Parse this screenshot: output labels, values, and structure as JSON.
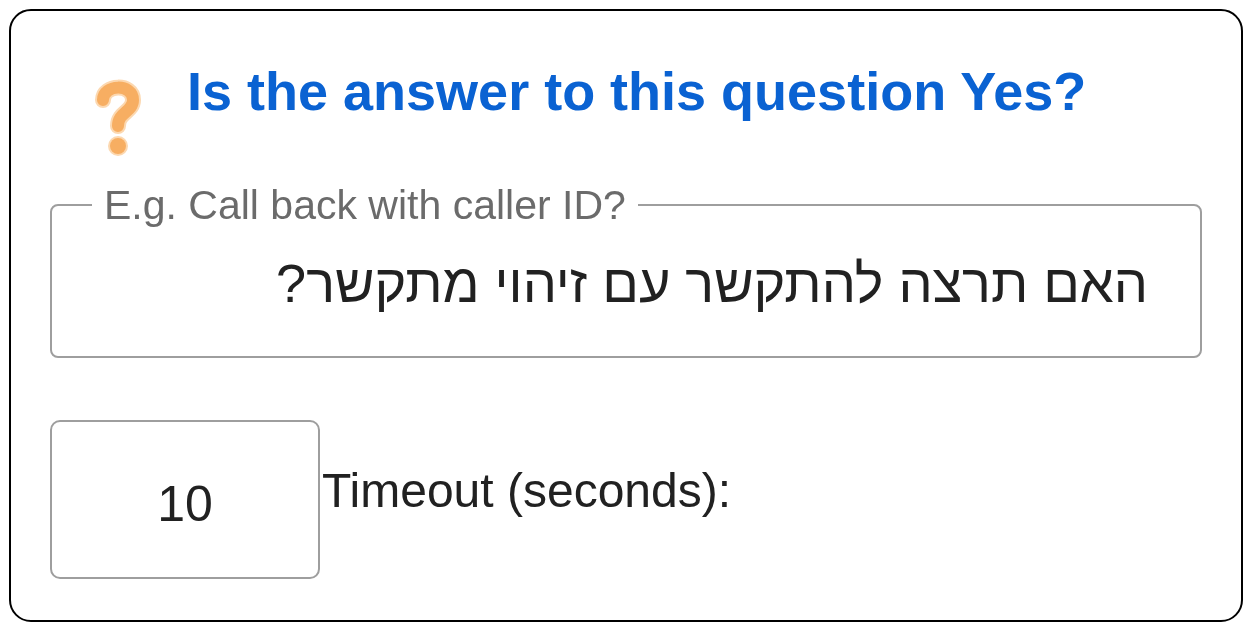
{
  "dialog": {
    "title": "Is the answer to this question Yes?"
  },
  "question_field": {
    "label": "E.g. Call back with caller ID?",
    "value": "האם תרצה להתקשר עם זיהוי מתקשר?"
  },
  "timeout_field": {
    "value": "10",
    "label": "Timeout (seconds):"
  }
}
